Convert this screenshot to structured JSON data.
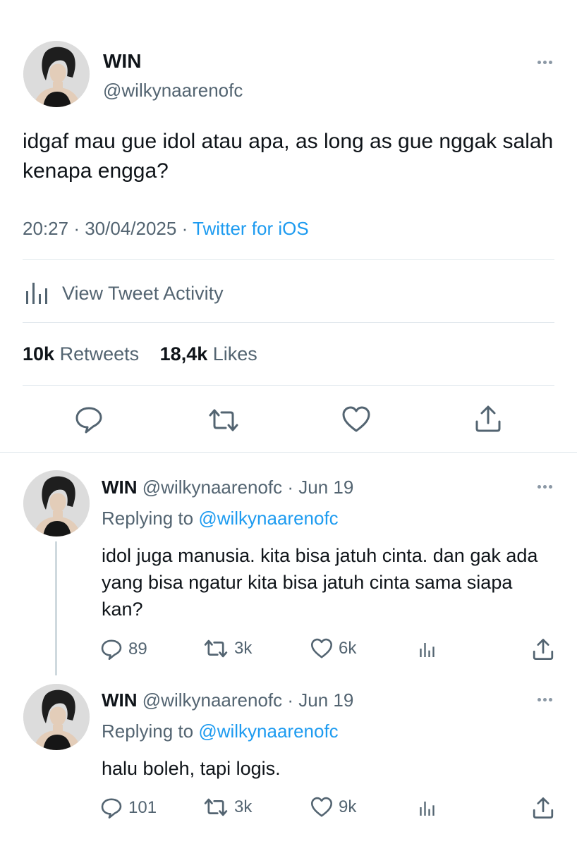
{
  "main": {
    "name": "WIN",
    "handle": "@wilkynaarenofc",
    "text": "idgaf mau gue idol atau apa, as long as gue nggak salah kenapa engga?",
    "time": "20:27",
    "date": "30/04/2025",
    "source": "Twitter for iOS",
    "activity_label": "View Tweet Activity",
    "retweets_count": "10k",
    "retweets_label": "Retweets",
    "likes_count": "18,4k",
    "likes_label": "Likes"
  },
  "replies": [
    {
      "name": "WIN",
      "handle": "@wilkynaarenofc",
      "date": "Jun 19",
      "replying_label": "Replying to",
      "replying_to": "@wilkynaarenofc",
      "text": "idol juga manusia. kita bisa jatuh cinta. dan gak ada yang bisa ngatur kita bisa jatuh cinta sama siapa kan?",
      "replies": "89",
      "retweets": "3k",
      "likes": "6k"
    },
    {
      "name": "WIN",
      "handle": "@wilkynaarenofc",
      "date": "Jun 19",
      "replying_label": "Replying to",
      "replying_to": "@wilkynaarenofc",
      "text": "halu boleh, tapi logis.",
      "replies": "101",
      "retweets": "3k",
      "likes": "9k"
    }
  ],
  "icons": {
    "reply": "reply-icon",
    "retweet": "retweet-icon",
    "like": "heart-icon",
    "share": "share-icon",
    "analytics": "analytics-icon",
    "more": "more-icon"
  },
  "colors": {
    "link": "#1d9bf0",
    "secondary": "#536471",
    "primary": "#0f1419"
  }
}
